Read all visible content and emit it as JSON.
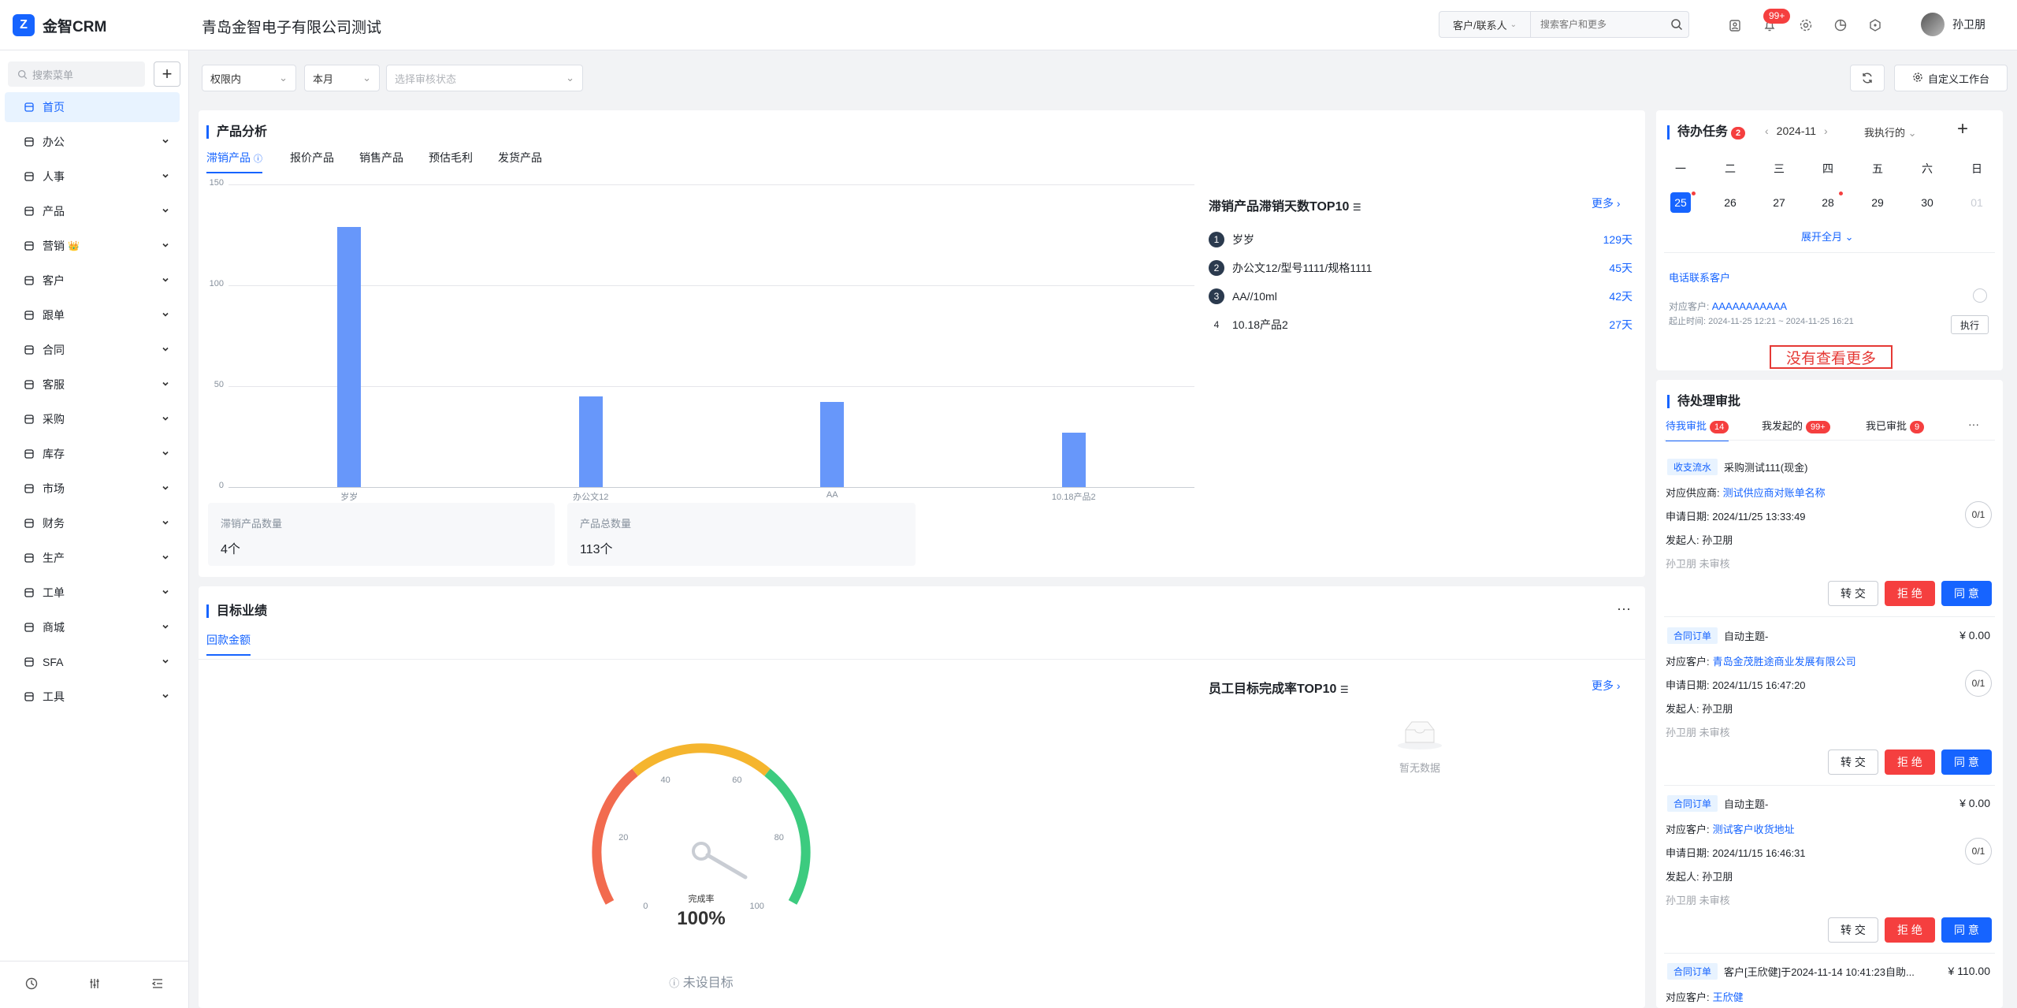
{
  "app": {
    "name": "金智CRM",
    "company": "青岛金智电子有限公司测试"
  },
  "topbar": {
    "search_type": "客户/联系人",
    "search_placeholder": "搜索客户和更多",
    "notify_badge": "99+",
    "user_name": "孙卫朋"
  },
  "sidebar": {
    "search_placeholder": "搜索菜单",
    "items": [
      {
        "label": "首页",
        "icon": "grid-icon"
      },
      {
        "label": "办公",
        "icon": "mail-icon"
      },
      {
        "label": "人事",
        "icon": "person-icon"
      },
      {
        "label": "产品",
        "icon": "cube-icon"
      },
      {
        "label": "营销",
        "icon": "copy-icon",
        "suffix": "👑"
      },
      {
        "label": "客户",
        "icon": "building-icon"
      },
      {
        "label": "跟单",
        "icon": "target-icon"
      },
      {
        "label": "合同",
        "icon": "contract-icon"
      },
      {
        "label": "客服",
        "icon": "headset-icon"
      },
      {
        "label": "采购",
        "icon": "bag-icon"
      },
      {
        "label": "库存",
        "icon": "warehouse-icon"
      },
      {
        "label": "市场",
        "icon": "book-icon"
      },
      {
        "label": "财务",
        "icon": "bank-icon"
      },
      {
        "label": "生产",
        "icon": "sliders-icon"
      },
      {
        "label": "工单",
        "icon": "ticket-icon"
      },
      {
        "label": "商城",
        "icon": "store-icon"
      },
      {
        "label": "SFA",
        "icon": "sync-icon"
      },
      {
        "label": "工具",
        "icon": "toolbox-icon"
      }
    ]
  },
  "filters": {
    "scope": "权限内",
    "period": "本月",
    "status_placeholder": "选择审核状态"
  },
  "toolbar": {
    "customize_label": "自定义工作台"
  },
  "product_analysis": {
    "title": "产品分析",
    "tabs": [
      "滞销产品",
      "报价产品",
      "销售产品",
      "预估毛利",
      "发货产品"
    ],
    "stat1_label": "滞销产品数量",
    "stat1_value": "4个",
    "stat2_label": "产品总数量",
    "stat2_value": "113个",
    "top_title": "滞销产品滞销天数TOP10",
    "more": "更多",
    "ranking": [
      {
        "rank": "1",
        "name": "岁岁",
        "value": "129天"
      },
      {
        "rank": "2",
        "name": "办公文12/型号1111/规格1111",
        "value": "45天"
      },
      {
        "rank": "3",
        "name": "AA//10ml",
        "value": "42天"
      },
      {
        "rank": "4",
        "name": "10.18产品2",
        "value": "27天"
      }
    ]
  },
  "chart_data": {
    "type": "bar",
    "categories": [
      "岁岁",
      "办公文12",
      "AA",
      "10.18产品2"
    ],
    "values": [
      129,
      45,
      42,
      27
    ],
    "ylim": [
      0,
      150
    ],
    "yticks": [
      "0",
      "50",
      "100",
      "150"
    ],
    "grid": true
  },
  "target": {
    "title": "目标业绩",
    "tab": "回款金额",
    "gauge_value": 100,
    "gauge_ticks": [
      "0",
      "20",
      "40",
      "60",
      "80",
      "100"
    ],
    "gauge_label": "完成率",
    "gauge_text": "100%",
    "no_target": "未设目标",
    "top_title": "员工目标完成率TOP10",
    "more": "更多",
    "empty": "暂无数据"
  },
  "tasks": {
    "title": "待办任务",
    "badge": "2",
    "month": "2024-11",
    "filter": "我执行的",
    "weekdays": [
      "一",
      "二",
      "三",
      "四",
      "五",
      "六",
      "日"
    ],
    "days": [
      "25",
      "26",
      "27",
      "28",
      "29",
      "30",
      "01"
    ],
    "expand": "展开全月",
    "task_title": "电话联系客户",
    "task_customer_label": "对应客户:",
    "task_customer": "AAAAAAAAAAA",
    "task_time": "起止时间: 2024-11-25 12:21 ~ 2024-11-25 16:21",
    "exec": "执行",
    "no_more": "没有查看更多"
  },
  "approvals": {
    "title": "待处理审批",
    "tabs": [
      {
        "label": "待我审批",
        "badge": "14"
      },
      {
        "label": "我发起的",
        "badge": "99+"
      },
      {
        "label": "我已审批",
        "badge": "9"
      }
    ],
    "items": [
      {
        "type": "收支流水",
        "subject": "采购测试111(现金)",
        "amount": "",
        "party_label": "对应供应商:",
        "party": "测试供应商对账单名称",
        "date": "申请日期: 2024/11/25 13:33:49",
        "progress": "0/1",
        "initiator": "发起人: 孙卫朋",
        "status": "孙卫朋 未审核"
      },
      {
        "type": "合同订单",
        "subject": "自动主题-",
        "amount": "¥ 0.00",
        "party_label": "对应客户:",
        "party": "青岛金茂胜途商业发展有限公司",
        "date": "申请日期: 2024/11/15 16:47:20",
        "progress": "0/1",
        "initiator": "发起人: 孙卫朋",
        "status": "孙卫朋 未审核"
      },
      {
        "type": "合同订单",
        "subject": "自动主题-",
        "amount": "¥ 0.00",
        "party_label": "对应客户:",
        "party": "测试客户收货地址",
        "date": "申请日期: 2024/11/15 16:46:31",
        "progress": "0/1",
        "initiator": "发起人: 孙卫朋",
        "status": "孙卫朋 未审核"
      },
      {
        "type": "合同订单",
        "subject": "客户[王欣健]于2024-11-14 10:41:23自助...",
        "amount": "¥ 110.00",
        "party_label": "对应客户:",
        "party": "王欣健"
      }
    ],
    "btn_transfer": "转 交",
    "btn_reject": "拒 绝",
    "btn_agree": "同 意"
  }
}
